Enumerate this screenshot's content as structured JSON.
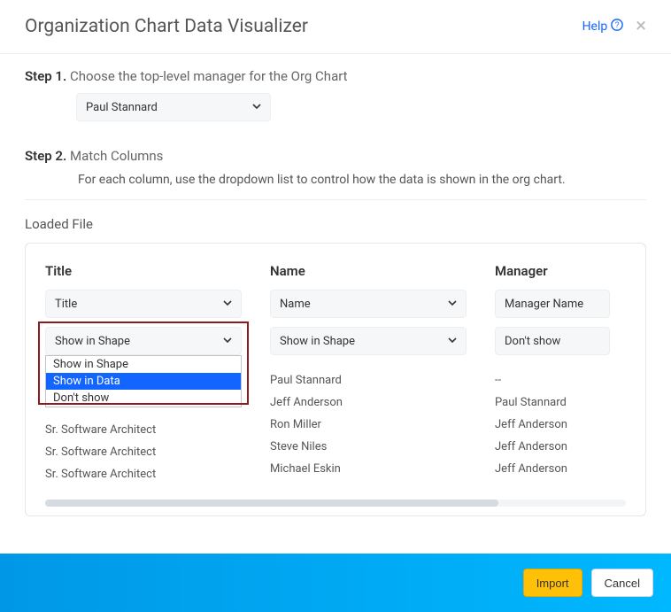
{
  "header": {
    "title": "Organization Chart Data Visualizer",
    "help_label": "Help",
    "close_label": "×"
  },
  "steps": {
    "step1": {
      "bold": "Step 1.",
      "text": "Choose the top-level manager for the Org Chart"
    },
    "step2": {
      "bold": "Step 2.",
      "text": "Match Columns",
      "sub": "For each column, use the dropdown list to control how the data is shown in the org chart."
    }
  },
  "manager_select": {
    "value": "Paul Stannard"
  },
  "loaded_label": "Loaded File",
  "columns": [
    {
      "header": "Title",
      "map_select": "Title",
      "display_select": "Show in Shape",
      "display_open": true,
      "display_options": [
        "Show in Shape",
        "Show in Data",
        "Don't show"
      ],
      "display_selected_index": 1,
      "rows": [
        "Sr. Software Architect",
        "Sr. Software Architect",
        "Sr. Software Architect"
      ]
    },
    {
      "header": "Name",
      "map_select": "Name",
      "display_select": "Show in Shape",
      "display_open": false,
      "rows": [
        "Paul Stannard",
        "Jeff Anderson",
        "Ron Miller",
        "Steve Niles",
        "Michael Eskin"
      ]
    },
    {
      "header": "Manager",
      "map_select": "Manager Name",
      "display_select": "Don't show",
      "display_open": false,
      "rows": [
        "--",
        "Paul Stannard",
        "Jeff Anderson",
        "Jeff Anderson",
        "Jeff Anderson"
      ]
    }
  ],
  "footer": {
    "import": "Import",
    "cancel": "Cancel"
  }
}
